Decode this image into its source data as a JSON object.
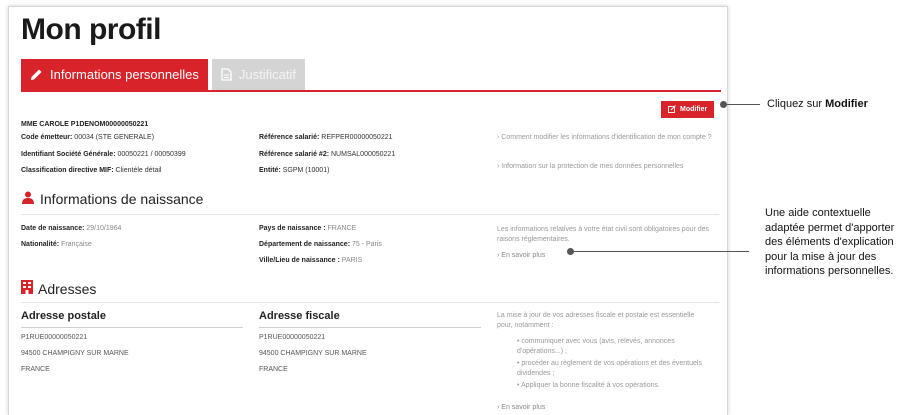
{
  "page_title": "Mon profil",
  "tabs": [
    {
      "label": "Informations personnelles",
      "active": true
    },
    {
      "label": "Justificatif",
      "active": false
    }
  ],
  "modify_button_label": "Modifier",
  "holder_name": "MME CAROLE P1DENOM00000050221",
  "identity": {
    "left": [
      {
        "label": "Code émetteur:",
        "value": "00034 (STE GENERALE)"
      },
      {
        "label": "Identifiant Société Générale:",
        "value": "00050221 / 00050399"
      },
      {
        "label": "Classification directive MIF:",
        "value": "Clientèle détail"
      }
    ],
    "right": [
      {
        "label": "Référence salarié:",
        "value": "REFPER00000050221"
      },
      {
        "label": "Référence salarié #2:",
        "value": "NUMSAL000050221"
      },
      {
        "label": "Entité:",
        "value": "SGPM (10001)"
      }
    ],
    "help_links": [
      "Comment modifier les informations d'identification de mon compte ?",
      "Information sur la protection de mes données personnelles"
    ]
  },
  "naissance": {
    "title": "Informations de naissance",
    "left": [
      {
        "label": "Date de naissance:",
        "value": "29/10/1964"
      },
      {
        "label": "Nationalité:",
        "value": "Française"
      }
    ],
    "right": [
      {
        "label": "Pays de naissance :",
        "value": "FRANCE"
      },
      {
        "label": "Département de naissance:",
        "value": "75 - Paris"
      },
      {
        "label": "Ville/Lieu de naissance :",
        "value": "PARIS"
      }
    ],
    "help_text": "Les informations relatives à votre état civil sont obligatoires pour des raisons réglementaires.",
    "help_link": "En savoir plus"
  },
  "adresses": {
    "title": "Adresses",
    "postale": {
      "title": "Adresse postale",
      "lines": [
        "P1RUE00000050221",
        "94500 CHAMPIGNY SUR MARNE",
        "FRANCE"
      ]
    },
    "fiscale": {
      "title": "Adresse fiscale",
      "lines": [
        "P1RUE00000050221",
        "94500 CHAMPIGNY SUR MARNE",
        "FRANCE"
      ]
    },
    "help_text": "La mise à jour de vos adresses fiscale et postale est essentielle pour, notamment :",
    "help_bullets": [
      "communiquer avec vous (avis, relevés, annonces d'opérations...) ;",
      "procéder au règlement de vos opérations et des éventuels dividendes ;",
      "Appliquer la bonne fiscalité à vos opérations."
    ],
    "help_link": "En savoir plus"
  },
  "callouts": {
    "modifier_prefix": "Cliquez sur",
    "modifier_bold": "Modifier",
    "aide": "Une aide contextuelle adaptée permet d'apporter des éléments d'explication pour la mise à jour des informations personnelles."
  },
  "colors": {
    "accent": "#d8232a",
    "tab_inactive": "#d4d4d4"
  },
  "icons": [
    "pencil-icon",
    "document-icon",
    "edit-icon",
    "person-icon",
    "building-icon",
    "chevron-right-icon"
  ]
}
